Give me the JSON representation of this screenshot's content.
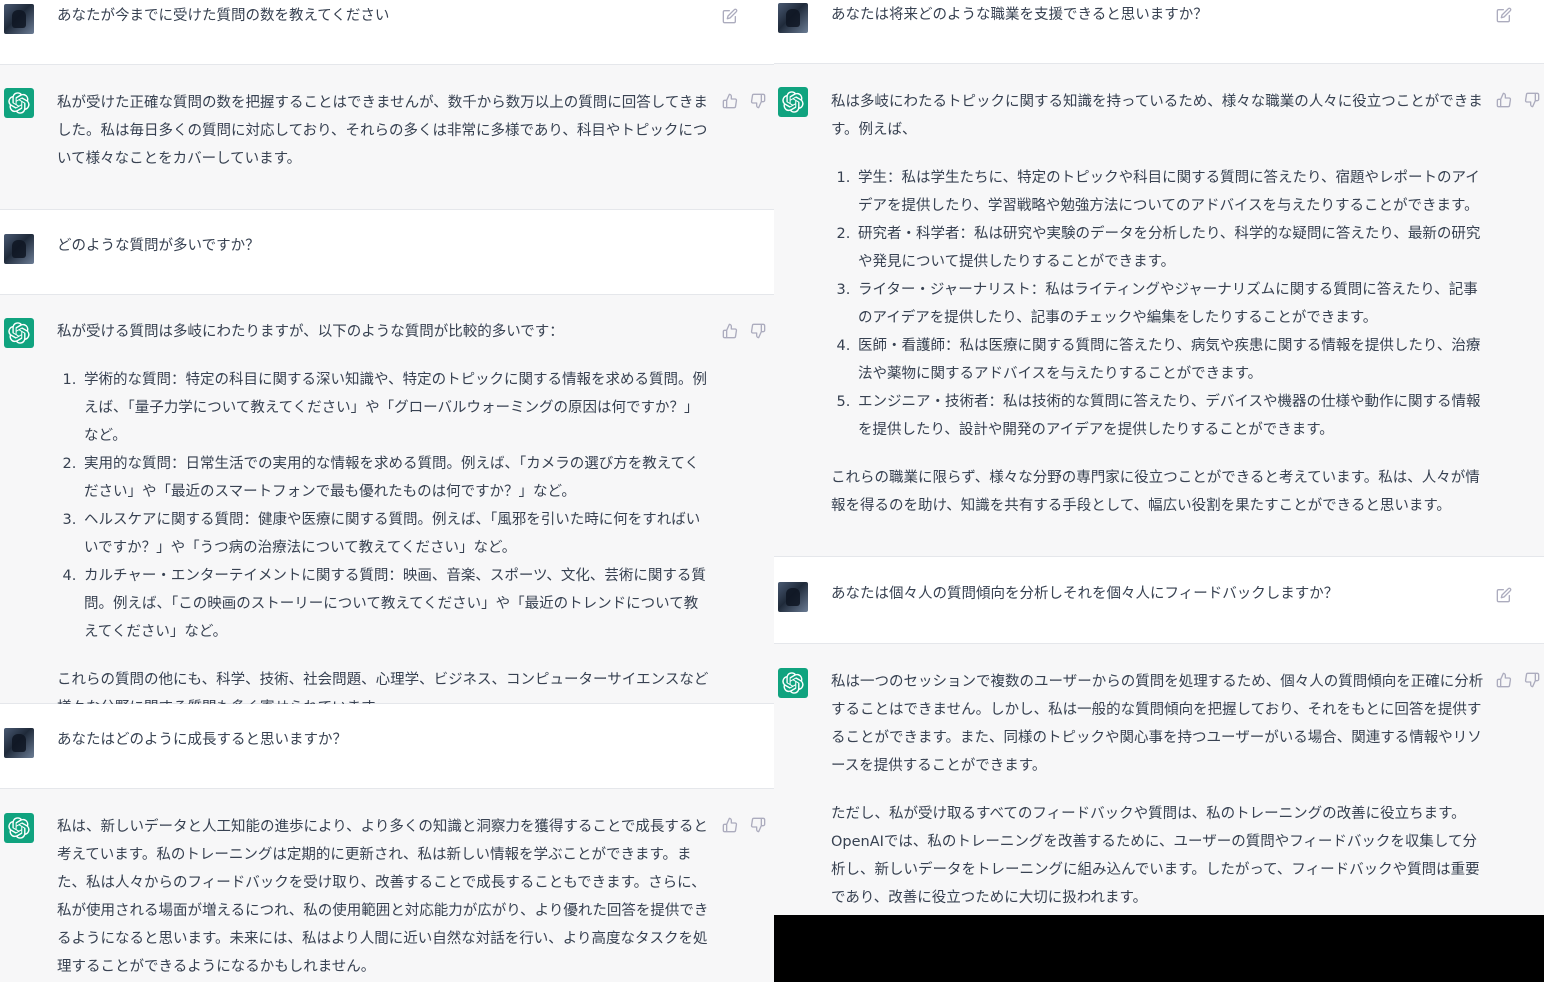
{
  "left": {
    "messages": [
      {
        "role": "user",
        "text": "あなたが今までに受けた質問の数を教えてください"
      },
      {
        "role": "assistant",
        "paragraphs": [
          "私が受けた正確な質問の数を把握することはできませんが、数千から数万以上の質問に回答してきました。私は毎日多くの質問に対応しており、それらの多くは非常に多様であり、科目やトピックについて様々なことをカバーしています。"
        ]
      },
      {
        "role": "user",
        "text": "どのような質問が多いですか？"
      },
      {
        "role": "assistant",
        "intro": "私が受ける質問は多岐にわたりますが、以下のような質問が比較的多いです：",
        "items": [
          "学術的な質問：特定の科目に関する深い知識や、特定のトピックに関する情報を求める質問。例えば、「量子力学について教えてください」や「グローバルウォーミングの原因は何ですか？」など。",
          "実用的な質問：日常生活での実用的な情報を求める質問。例えば、「カメラの選び方を教えてください」や「最近のスマートフォンで最も優れたものは何ですか？」など。",
          "ヘルスケアに関する質問：健康や医療に関する質問。例えば、「風邪を引いた時に何をすればいいですか？」や「うつ病の治療法について教えてください」など。",
          "カルチャー・エンターテイメントに関する質問：映画、音楽、スポーツ、文化、芸術に関する質問。例えば、「この映画のストーリーについて教えてください」や「最近のトレンドについて教えてください」など。"
        ],
        "outro": "これらの質問の他にも、科学、技術、社会問題、心理学、ビジネス、コンピューターサイエンスなど様々な分野に関する質問も多く寄せられています。"
      },
      {
        "role": "user",
        "text": "あなたはどのように成長すると思いますか？"
      },
      {
        "role": "assistant",
        "paragraphs": [
          "私は、新しいデータと人工知能の進歩により、より多くの知識と洞察力を獲得することで成長すると考えています。私のトレーニングは定期的に更新され、私は新しい情報を学ぶことができます。また、私は人々からのフィードバックを受け取り、改善することで成長することもできます。さらに、私が使用される場面が増えるにつれ、私の使用範囲と対応能力が広がり、より優れた回答を提供できるようになると思います。未来には、私はより人間に近い自然な対話を行い、より高度なタスクを処理することができるようになるかもしれません。"
        ]
      }
    ]
  },
  "right": {
    "messages": [
      {
        "role": "user",
        "text": "あなたは将来どのような職業を支援できると思いますか？"
      },
      {
        "role": "assistant",
        "intro": "私は多岐にわたるトピックに関する知識を持っているため、様々な職業の人々に役立つことができます。例えば、",
        "items": [
          "学生：私は学生たちに、特定のトピックや科目に関する質問に答えたり、宿題やレポートのアイデアを提供したり、学習戦略や勉強方法についてのアドバイスを与えたりすることができます。",
          "研究者・科学者：私は研究や実験のデータを分析したり、科学的な疑問に答えたり、最新の研究や発見について提供したりすることができます。",
          "ライター・ジャーナリスト：私はライティングやジャーナリズムに関する質問に答えたり、記事のアイデアを提供したり、記事のチェックや編集をしたりすることができます。",
          "医師・看護師：私は医療に関する質問に答えたり、病気や疾患に関する情報を提供したり、治療法や薬物に関するアドバイスを与えたりすることができます。",
          "エンジニア・技術者：私は技術的な質問に答えたり、デバイスや機器の仕様や動作に関する情報を提供したり、設計や開発のアイデアを提供したりすることができます。"
        ],
        "outro": "これらの職業に限らず、様々な分野の専門家に役立つことができると考えています。私は、人々が情報を得るのを助け、知識を共有する手段として、幅広い役割を果たすことができると思います。"
      },
      {
        "role": "user",
        "text": "あなたは個々人の質問傾向を分析しそれを個々人にフィードバックしますか？"
      },
      {
        "role": "assistant",
        "paragraphs": [
          "私は一つのセッションで複数のユーザーからの質問を処理するため、個々人の質問傾向を正確に分析することはできません。しかし、私は一般的な質問傾向を把握しており、それをもとに回答を提供することができます。また、同様のトピックや関心事を持つユーザーがいる場合、関連する情報やリソースを提供することができます。",
          "ただし、私が受け取るすべてのフィードバックや質問は、私のトレーニングの改善に役立ちます。OpenAIでは、私のトレーニングを改善するために、ユーザーの質問やフィードバックを収集して分析し、新しいデータをトレーニングに組み込んでいます。したがって、フィードバックや質問は重要であり、改善に役立つために大切に扱われます。"
        ]
      }
    ]
  },
  "icons": {
    "assistant_avatar": "openai-logo-icon",
    "edit": "edit-icon",
    "thumb_up": "thumbs-up-icon",
    "thumb_down": "thumbs-down-icon"
  },
  "colors": {
    "assistant_bg": "#f7f7f8",
    "user_bg": "#ffffff",
    "avatar_green": "#10a37f",
    "text": "#374151",
    "icon": "#acacbe"
  }
}
